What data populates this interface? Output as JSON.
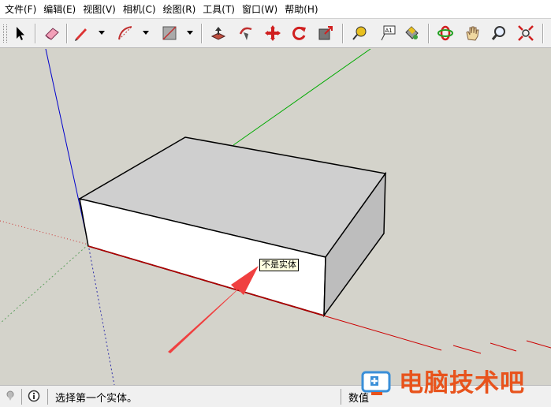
{
  "menu": {
    "items": [
      {
        "label": "文件(F)"
      },
      {
        "label": "编辑(E)"
      },
      {
        "label": "视图(V)"
      },
      {
        "label": "相机(C)"
      },
      {
        "label": "绘图(R)"
      },
      {
        "label": "工具(T)"
      },
      {
        "label": "窗口(W)"
      },
      {
        "label": "帮助(H)"
      }
    ]
  },
  "toolbar": {
    "icons": [
      "select-icon",
      "eraser-icon",
      "pencil-icon",
      "arc-icon",
      "rectangle-icon",
      "push-pull-icon",
      "follow-me-icon",
      "move-icon",
      "rotate-icon",
      "offset-icon",
      "tape-measure-icon",
      "text-label-icon",
      "paint-bucket-icon",
      "orbit-icon",
      "pan-icon",
      "zoom-icon",
      "zoom-extents-icon"
    ],
    "text_label": "A1"
  },
  "viewport": {
    "tooltip": "不是实体",
    "colors": {
      "red_axis": "#cc0000",
      "green_axis": "#00aa00",
      "blue_axis": "#0000cc",
      "arrow": "#f04040"
    }
  },
  "status": {
    "message": "选择第一个实体。",
    "measurements_label": "数值"
  },
  "watermark": {
    "text": "电脑技术吧",
    "color": "#e8531c"
  }
}
